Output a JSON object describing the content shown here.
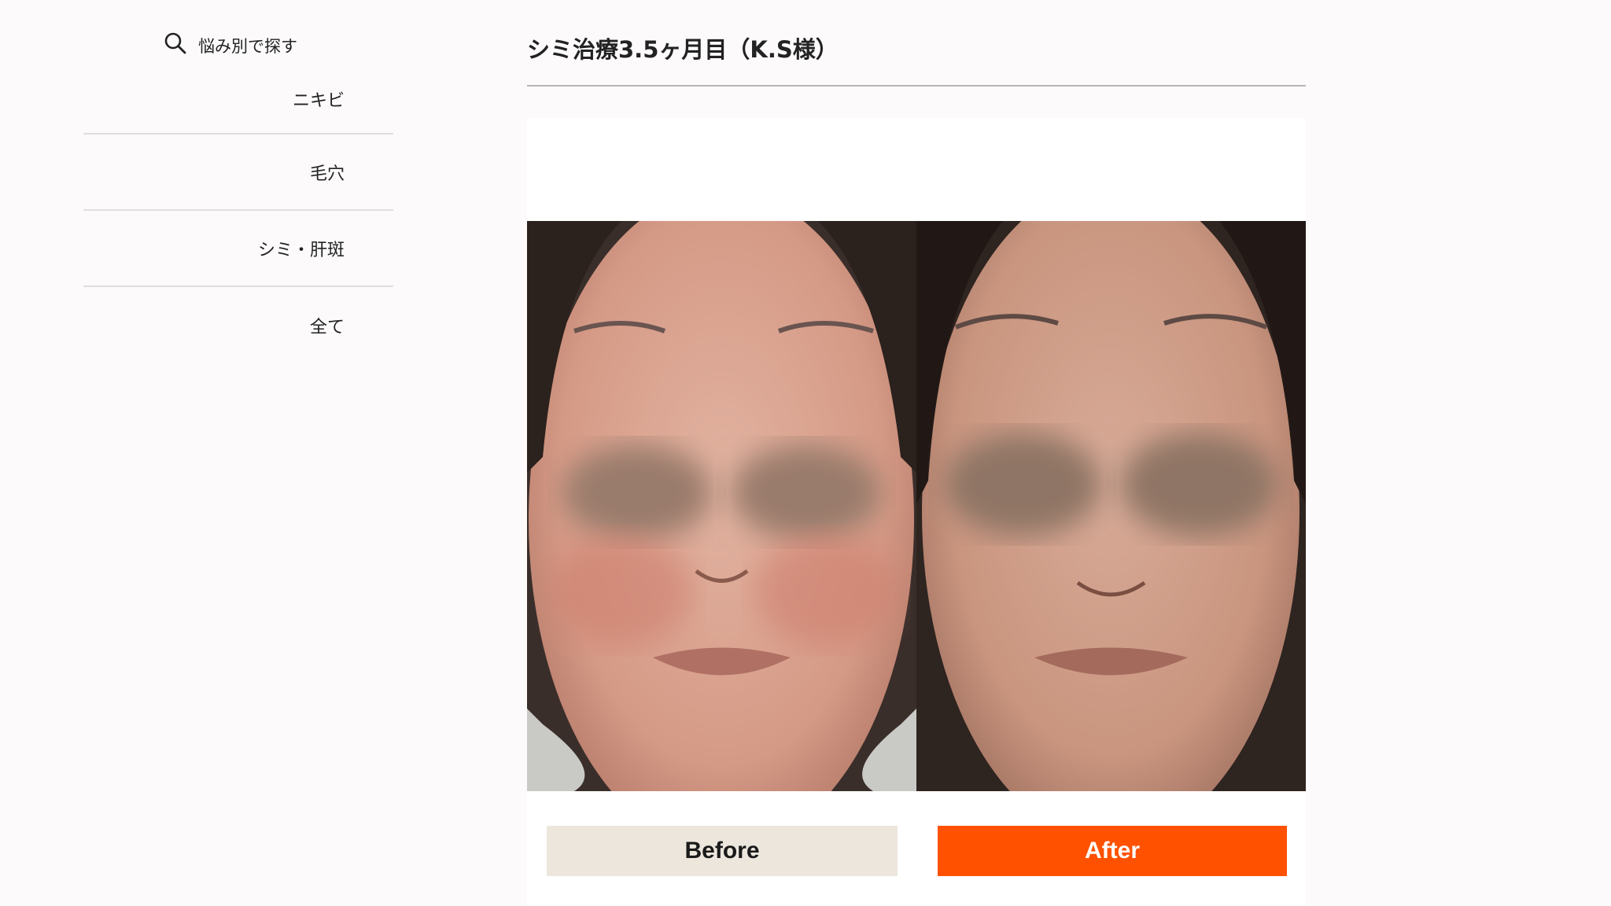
{
  "sidebar": {
    "search_label": "悩み別で探す",
    "items": [
      {
        "label": "ニキビ"
      },
      {
        "label": "毛穴"
      },
      {
        "label": "シミ・肝斑"
      },
      {
        "label": "全て"
      }
    ]
  },
  "main": {
    "title": "シミ治療3.5ヶ月目（K.S様）",
    "before_label": "Before",
    "after_label": "After"
  },
  "colors": {
    "accent": "#ff5100",
    "before_button": "#ede6dd",
    "divider": "#e2dedd"
  },
  "icons": {
    "search": "search-icon"
  }
}
